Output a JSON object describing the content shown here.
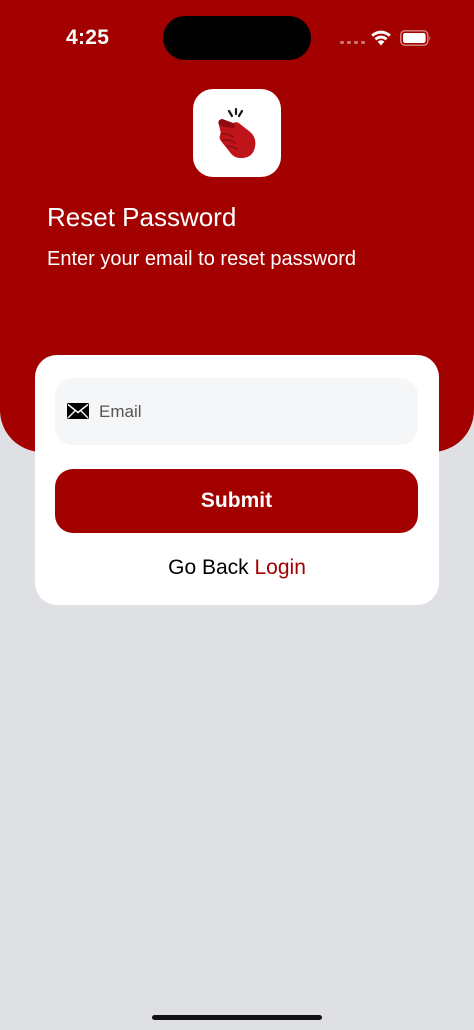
{
  "status_bar": {
    "time": "4:25"
  },
  "header": {
    "app_icon": "snap-hand-icon",
    "title": "Reset Password",
    "subtitle": "Enter your email to reset password"
  },
  "form": {
    "email_icon": "envelope-icon",
    "email_placeholder": "Email",
    "email_value": "",
    "submit_label": "Submit",
    "go_back_text": "Go Back",
    "login_link": "Login"
  },
  "colors": {
    "brand": "#A30000",
    "background": "#DFE0E4",
    "card": "#FFFFFF",
    "field": "#F5F6F8"
  }
}
